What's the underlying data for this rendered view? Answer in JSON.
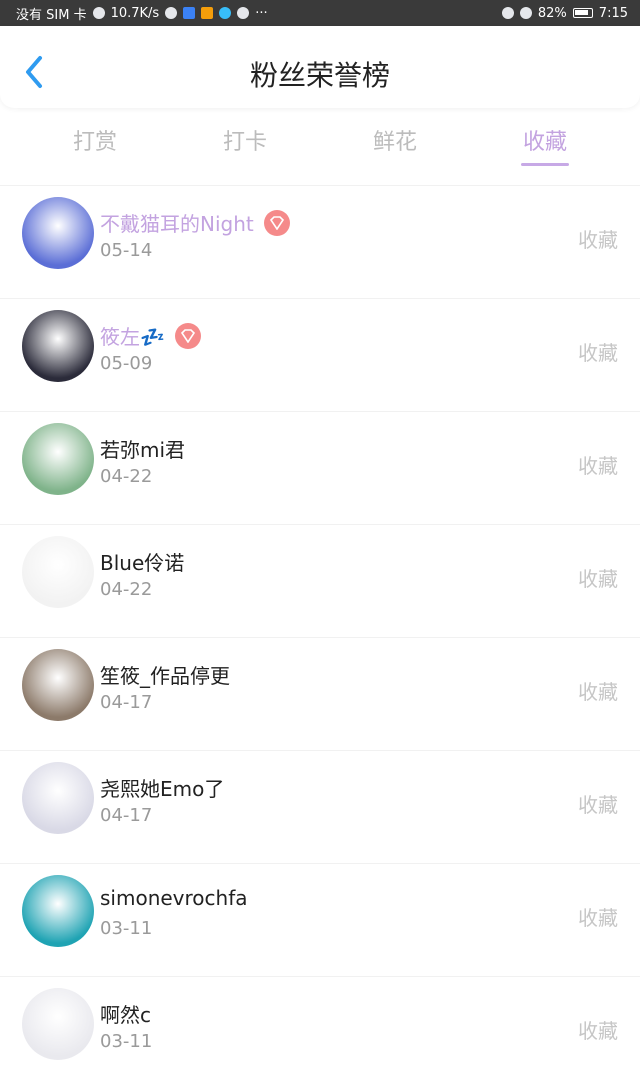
{
  "status_bar": {
    "carrier": "没有 SIM 卡",
    "speed": "10.7K/s",
    "more": "···",
    "battery_percent": "82%",
    "time": "7:15"
  },
  "header": {
    "title": "粉丝荣誉榜"
  },
  "tabs": [
    {
      "label": "打赏",
      "active": false
    },
    {
      "label": "打卡",
      "active": false
    },
    {
      "label": "鲜花",
      "active": false
    },
    {
      "label": "收藏",
      "active": true
    }
  ],
  "list": {
    "items": [
      {
        "name": "不戴猫耳的Night",
        "date": "05-14",
        "action": "收藏",
        "vip": true,
        "avatar_color": "#5b6ed6"
      },
      {
        "name": "筱左💤",
        "date": "05-09",
        "action": "收藏",
        "vip": true,
        "avatar_color": "#2b2b3a"
      },
      {
        "name": "若弥mi君",
        "date": "04-22",
        "action": "收藏",
        "vip": false,
        "avatar_color": "#7fb38a"
      },
      {
        "name": "Blue伶诺",
        "date": "04-22",
        "action": "收藏",
        "vip": false,
        "avatar_color": "#f2f2f2"
      },
      {
        "name": "笙筱_作品停更",
        "date": "04-17",
        "action": "收藏",
        "vip": false,
        "avatar_color": "#8c7a6a"
      },
      {
        "name": "尧熙她Emo了",
        "date": "04-17",
        "action": "收藏",
        "vip": false,
        "avatar_color": "#d9d9e6"
      },
      {
        "name": "simonevrochfa",
        "date": "03-11",
        "action": "收藏",
        "vip": false,
        "avatar_color": "#1fa3b3"
      },
      {
        "name": "啊然c",
        "date": "03-11",
        "action": "收藏",
        "vip": false,
        "avatar_color": "#e9e9ee"
      }
    ]
  },
  "colors": {
    "accent": "#c3a3e0",
    "back_icon": "#2f9bf0",
    "vip_badge": "#f58a8a",
    "tab_inactive": "#bcbcbc",
    "date": "#9a9a9a",
    "action": "#c6c6c6"
  }
}
